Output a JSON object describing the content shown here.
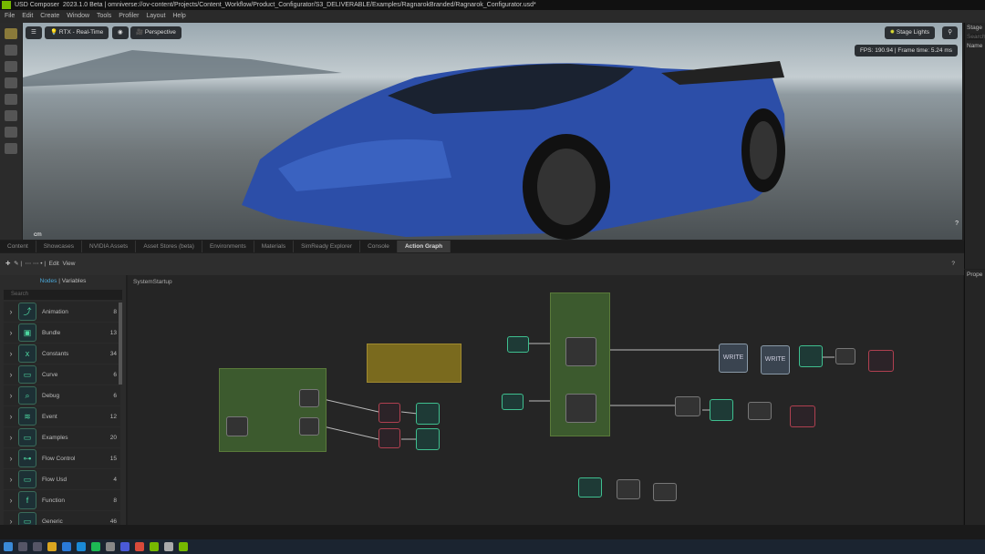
{
  "titlebar": {
    "app": "USD Composer",
    "version": "2023.1.0 Beta",
    "path": "omniverse://ov-content/Projects/Content_Workflow/Product_Configurator/S3_DELIVERABLE/Examples/RagnarokBranded/Ragnarok_Configurator.usd*"
  },
  "menu": [
    "File",
    "Edit",
    "Create",
    "Window",
    "Tools",
    "Profiler",
    "Layout",
    "Help"
  ],
  "viewport": {
    "render_mode": "RTX - Real-Time",
    "camera": "Perspective",
    "stage_lights": "Stage Lights",
    "fps": "FPS: 190.94 | Frame time: 5.24 ms",
    "units": "cm"
  },
  "stage_panel": {
    "title": "Stage",
    "search": "Search",
    "name_col": "Name"
  },
  "property_panel": {
    "title": "Prope"
  },
  "tabs": [
    {
      "label": "Content"
    },
    {
      "label": "Showcases"
    },
    {
      "label": "NVIDIA Assets"
    },
    {
      "label": "Asset Stores (beta)"
    },
    {
      "label": "Environments"
    },
    {
      "label": "Materials"
    },
    {
      "label": "SimReady Explorer"
    },
    {
      "label": "Console"
    },
    {
      "label": "Action Graph",
      "active": true
    }
  ],
  "graph_toolbar": {
    "edit": "Edit",
    "view": "View",
    "help": "?"
  },
  "nodes_panel": {
    "tab_nodes": "Nodes",
    "tab_variables": "Variables",
    "search_placeholder": "Search",
    "items": [
      {
        "label": "Animation",
        "count": "8",
        "icon": "⤴"
      },
      {
        "label": "Bundle",
        "count": "13",
        "icon": "▣"
      },
      {
        "label": "Constants",
        "count": "34",
        "icon": "x"
      },
      {
        "label": "Curve",
        "count": "6",
        "icon": "▭"
      },
      {
        "label": "Debug",
        "count": "6",
        "icon": "⌕"
      },
      {
        "label": "Event",
        "count": "12",
        "icon": "≋"
      },
      {
        "label": "Examples",
        "count": "20",
        "icon": "▭"
      },
      {
        "label": "Flow Control",
        "count": "15",
        "icon": "⊶"
      },
      {
        "label": "Flow Usd",
        "count": "4",
        "icon": "▭"
      },
      {
        "label": "Function",
        "count": "8",
        "icon": "f"
      },
      {
        "label": "Generic",
        "count": "46",
        "icon": "▭"
      }
    ]
  },
  "graph": {
    "title": "SystemStartup",
    "write_label": "WRITE"
  }
}
